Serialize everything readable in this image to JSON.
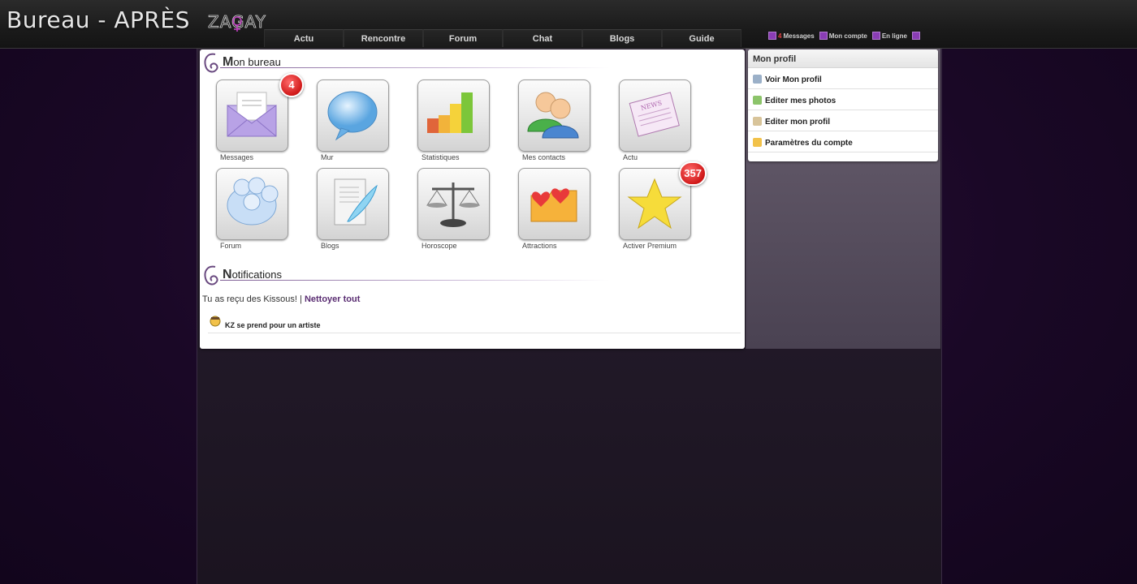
{
  "header": {
    "title": "Bureau - APRÈS",
    "logo_text": "ZAGAY",
    "nav": [
      "Actu",
      "Rencontre",
      "Forum",
      "Chat",
      "Blogs",
      "Guide"
    ],
    "user_links": {
      "messages_count": "4",
      "messages": "Messages",
      "account": "Mon compte",
      "online": "En ligne"
    }
  },
  "bureau": {
    "title_cap": "M",
    "title_rest": "on bureau",
    "tiles": [
      {
        "label": "Messages",
        "icon": "envelope-icon",
        "badge": "4"
      },
      {
        "label": "Mur",
        "icon": "speech-bubble-icon",
        "badge": null
      },
      {
        "label": "Statistiques",
        "icon": "bar-chart-icon",
        "badge": null
      },
      {
        "label": "Mes contacts",
        "icon": "contacts-icon",
        "badge": null
      },
      {
        "label": "Actu",
        "icon": "newspaper-icon",
        "badge": null
      },
      {
        "label": "Forum",
        "icon": "forum-bubbles-icon",
        "badge": null
      },
      {
        "label": "Blogs",
        "icon": "blog-feather-icon",
        "badge": null
      },
      {
        "label": "Horoscope",
        "icon": "scales-icon",
        "badge": null
      },
      {
        "label": "Attractions",
        "icon": "hearts-folder-icon",
        "badge": null
      },
      {
        "label": "Activer Premium",
        "icon": "star-icon",
        "badge": "357"
      }
    ]
  },
  "notifications": {
    "title_cap": "N",
    "title_rest": "otifications",
    "kiss_text": "Tu as reçu des Kissous! |",
    "clear_all": "Nettoyer tout",
    "items": [
      {
        "text": "KZ se prend pour un artiste"
      }
    ]
  },
  "profile": {
    "title": "Mon profil",
    "links": [
      {
        "label": "Voir Mon profil",
        "icon": "profile-view-icon"
      },
      {
        "label": "Editer mes photos",
        "icon": "photos-icon"
      },
      {
        "label": "Editer mon profil",
        "icon": "edit-profile-icon"
      },
      {
        "label": "Paramètres du compte",
        "icon": "folder-settings-icon"
      }
    ]
  },
  "colors": {
    "accent": "#5a2d72",
    "badge": "#d01818",
    "background": "#1a0826"
  }
}
